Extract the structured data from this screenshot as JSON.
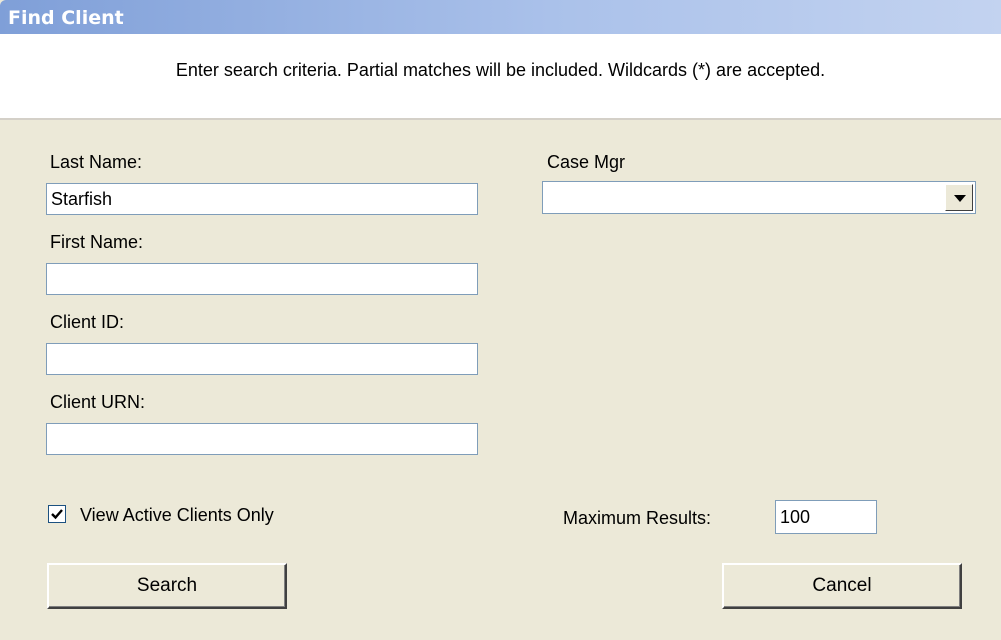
{
  "window": {
    "title": "Find Client"
  },
  "header": {
    "instructions": "Enter search criteria. Partial matches will be included. Wildcards (*) are accepted."
  },
  "form": {
    "last_name": {
      "label": "Last Name:",
      "value": "Starfish"
    },
    "first_name": {
      "label": "First Name:",
      "value": ""
    },
    "client_id": {
      "label": "Client ID:",
      "value": ""
    },
    "client_urn": {
      "label": "Client URN:",
      "value": ""
    },
    "case_mgr": {
      "label": "Case Mgr",
      "value": ""
    },
    "active_only": {
      "label": "View Active Clients Only",
      "checked": true
    },
    "max_results": {
      "label": "Maximum Results:",
      "value": "100"
    }
  },
  "buttons": {
    "search": "Search",
    "cancel": "Cancel"
  },
  "colors": {
    "title_bar_start": "#7f9fd8",
    "title_bar_end": "#c3d3f0",
    "dialog_bg": "#ece9d8",
    "input_border": "#7f9db9"
  },
  "icons": {
    "dropdown": "chevron-down-icon",
    "check": "checkmark-icon"
  }
}
